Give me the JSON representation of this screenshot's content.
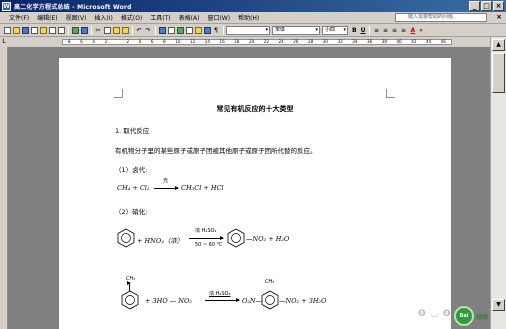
{
  "window": {
    "title": "高二化学方程式总结 - Microsoft Word",
    "app_icon": "W",
    "btn_minimize": "_",
    "btn_maximize": "□",
    "btn_close": "×"
  },
  "menu": {
    "items": [
      "文件(F)",
      "编辑(E)",
      "视图(V)",
      "插入(I)",
      "格式(O)",
      "工具(T)",
      "表格(A)",
      "窗口(W)",
      "帮助(H)"
    ],
    "help_placeholder": "键入需要帮助的问题",
    "close_doc": "×"
  },
  "toolbar": {
    "font_name": "宋体",
    "font_size": "小四",
    "bold": "B",
    "underline": "U",
    "font_color": "A"
  },
  "ruler": {
    "ticks": [
      "8",
      "6",
      "4",
      "2",
      "",
      "2",
      "4",
      "6",
      "8",
      "10",
      "12",
      "14",
      "16",
      "18",
      "20",
      "22",
      "24",
      "26",
      "28",
      "30",
      "32",
      "34",
      "36",
      "38",
      "40",
      "42",
      "44",
      "46"
    ]
  },
  "document": {
    "title": "常见有机反应的十大类型",
    "section1": "1. 取代反应",
    "definition": "有机物分子里的某些原子或原子团被其他原子或原子团所代替的反应。",
    "item1": "（1）卤代:",
    "eq1_left": "CH₄ + Cl₂",
    "eq1_cond": "光",
    "eq1_right": "CH₃Cl + HCl",
    "item2": "（2）硝化:",
    "eq2_plus": "+ HNO₃（浓）",
    "eq2_cond_top": "浓 H₂SO₄",
    "eq2_cond_bottom": "50 ~ 60 ℃",
    "eq2_right": "—NO₂ + H₂O",
    "eq3_ch3": "CH₃",
    "eq3_mid": "+ 3HO — NO₂",
    "eq3_cond": "浓 H₂SO₄",
    "eq3_o2n": "O₂N—",
    "eq3_ch3b": "CH₃",
    "eq3_right": "—NO₂ + 3H₂O"
  },
  "scrollbar": {
    "up": "▲",
    "down": "▼"
  },
  "watermark": {
    "badge": "Bai",
    "text": "经验"
  }
}
